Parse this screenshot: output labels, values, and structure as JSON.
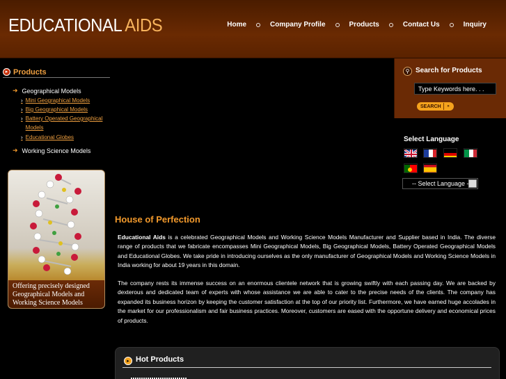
{
  "header": {
    "logo_word1": "EDUCATIONAL",
    "logo_word2": "AIDS",
    "nav": [
      "Home",
      "Company Profile",
      "Products",
      "Contact Us",
      "Inquiry"
    ]
  },
  "sidebar": {
    "title": "Products",
    "categories": [
      {
        "label": "Geographical Models",
        "subs": [
          "Mini Geographical Models",
          "Big Geographical Models",
          "Battery Operated Geographical Models",
          "Educational Globes"
        ]
      },
      {
        "label": "Working Science Models",
        "subs": []
      }
    ],
    "promo_caption": "Offering precisely designed Geographical Models and Working Science Models"
  },
  "search": {
    "title": "Search for Products",
    "placeholder": "Type Keywords here. . .",
    "button": "SEARCH",
    "button_go": "»"
  },
  "language": {
    "title": "Select Language",
    "flags": [
      "uk-flag",
      "france-flag",
      "germany-flag",
      "italy-flag",
      "portugal-flag",
      "spain-flag"
    ],
    "select_value": "-- Select Language --"
  },
  "main": {
    "title": "House of Perfection",
    "para1_bold": "Educational Aids",
    "para1": " is a celebrated Geographical Models and Working Science Models Manufacturer and Supplier based in India. The diverse range of products that we fabricate encompasses Mini Geographical Models, Big Geographical Models, Battery Operated Geographical Models and Educational Globes. We take pride in introducing ourselves as the only manufacturer of Geographical Models and Working Science Models in India working for about 19 years in this domain.",
    "para2": "The company rests its immense success on an enormous clientele network that is growing swiftly with each passing day. We are backed by dexterous and dedicated team of experts with whose assistance we are able to cater to the precise needs of the clients. The company has expanded its business horizon by keeping the customer satisfaction at the top of our priority list. Furthermore, we have earned huge accolades in the market for our professionalism and fair business practices. Moreover, customers are eased with the opportune delivery and economical prices of products."
  },
  "hot_products": {
    "title": "Hot Products"
  },
  "colors": {
    "accent": "#f39a2c",
    "header_bg": "#5a2200",
    "search_bg": "#6a2a05"
  }
}
